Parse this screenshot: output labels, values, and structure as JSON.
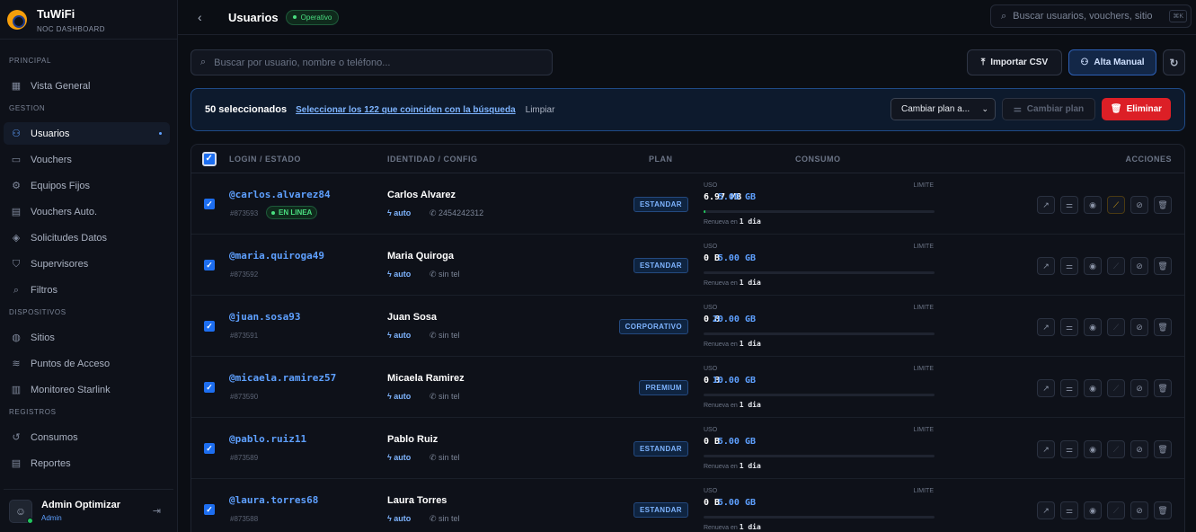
{
  "brand": {
    "title": "TuWiFi",
    "subtitle": "NOC DASHBOARD"
  },
  "nav": {
    "sections": [
      {
        "label": "PRINCIPAL",
        "items": [
          {
            "label": "Vista General",
            "icon": "grid-icon"
          }
        ]
      },
      {
        "label": "GESTION",
        "items": [
          {
            "label": "Usuarios",
            "icon": "users-icon",
            "active": true
          },
          {
            "label": "Vouchers",
            "icon": "ticket-icon"
          },
          {
            "label": "Equipos Fijos",
            "icon": "router-icon"
          },
          {
            "label": "Vouchers Auto.",
            "icon": "calendar-icon"
          },
          {
            "label": "Solicitudes Datos",
            "icon": "shield-icon"
          },
          {
            "label": "Supervisores",
            "icon": "shield-check-icon"
          },
          {
            "label": "Filtros",
            "icon": "search-icon"
          }
        ]
      },
      {
        "label": "DISPOSITIVOS",
        "items": [
          {
            "label": "Sitios",
            "icon": "globe-icon"
          },
          {
            "label": "Puntos de Acceso",
            "icon": "wifi-icon"
          },
          {
            "label": "Monitoreo Starlink",
            "icon": "satellite-icon"
          }
        ]
      },
      {
        "label": "REGISTROS",
        "items": [
          {
            "label": "Consumos",
            "icon": "history-icon"
          },
          {
            "label": "Reportes",
            "icon": "report-icon"
          }
        ]
      }
    ]
  },
  "user": {
    "name": "Admin Optimizar",
    "role": "Admin"
  },
  "header": {
    "title": "Usuarios",
    "status": "Operativo",
    "search_placeholder": "Buscar usuarios, vouchers, sitio",
    "shortcut": "⌘K"
  },
  "toolbar": {
    "search_placeholder": "Buscar por usuario, nombre o teléfono...",
    "import_label": "Importar CSV",
    "alta_label": "Alta Manual"
  },
  "selection": {
    "count_label": "50 seleccionados",
    "select_all_label": "Seleccionar los 122 que coinciden con la búsqueda",
    "clear_label": "Limpiar",
    "plan_select": "Cambiar plan a...",
    "change_plan_label": "Cambiar plan",
    "delete_label": "Eliminar"
  },
  "table": {
    "headers": {
      "login": "LOGIN / ESTADO",
      "identity": "IDENTIDAD / CONFIG",
      "plan": "PLAN",
      "consumo": "CONSUMO",
      "acciones": "ACCIONES"
    },
    "uso_label": "USO",
    "limite_label": "LIMITE",
    "renew_prefix": "Renueva en",
    "rows": [
      {
        "login": "@carlos.alvarez84",
        "id": "#873593",
        "online": "EN LINEA",
        "name": "Carlos Alvarez",
        "config": "auto",
        "phone": "2454242312",
        "plan": "ESTANDAR",
        "uso": "6.97 MB",
        "limite": "5.00 GB",
        "renew": "1 dia",
        "usage_fraction": 0.0014
      },
      {
        "login": "@maria.quiroga49",
        "id": "#873592",
        "online": "",
        "name": "Maria Quiroga",
        "config": "auto",
        "phone": "sin tel",
        "plan": "ESTANDAR",
        "uso": "0 B",
        "limite": "5.00 GB",
        "renew": "1 dia",
        "usage_fraction": 0
      },
      {
        "login": "@juan.sosa93",
        "id": "#873591",
        "online": "",
        "name": "Juan Sosa",
        "config": "auto",
        "phone": "sin tel",
        "plan": "CORPORATIVO",
        "uso": "0 B",
        "limite": "20.00 GB",
        "renew": "1 dia",
        "usage_fraction": 0
      },
      {
        "login": "@micaela.ramirez57",
        "id": "#873590",
        "online": "",
        "name": "Micaela Ramirez",
        "config": "auto",
        "phone": "sin tel",
        "plan": "PREMIUM",
        "uso": "0 B",
        "limite": "10.00 GB",
        "renew": "1 dia",
        "usage_fraction": 0
      },
      {
        "login": "@pablo.ruiz11",
        "id": "#873589",
        "online": "",
        "name": "Pablo Ruiz",
        "config": "auto",
        "phone": "sin tel",
        "plan": "ESTANDAR",
        "uso": "0 B",
        "limite": "5.00 GB",
        "renew": "1 dia",
        "usage_fraction": 0
      },
      {
        "login": "@laura.torres68",
        "id": "#873588",
        "online": "",
        "name": "Laura Torres",
        "config": "auto",
        "phone": "sin tel",
        "plan": "ESTANDAR",
        "uso": "0 B",
        "limite": "5.00 GB",
        "renew": "1 dia",
        "usage_fraction": 0
      }
    ]
  }
}
